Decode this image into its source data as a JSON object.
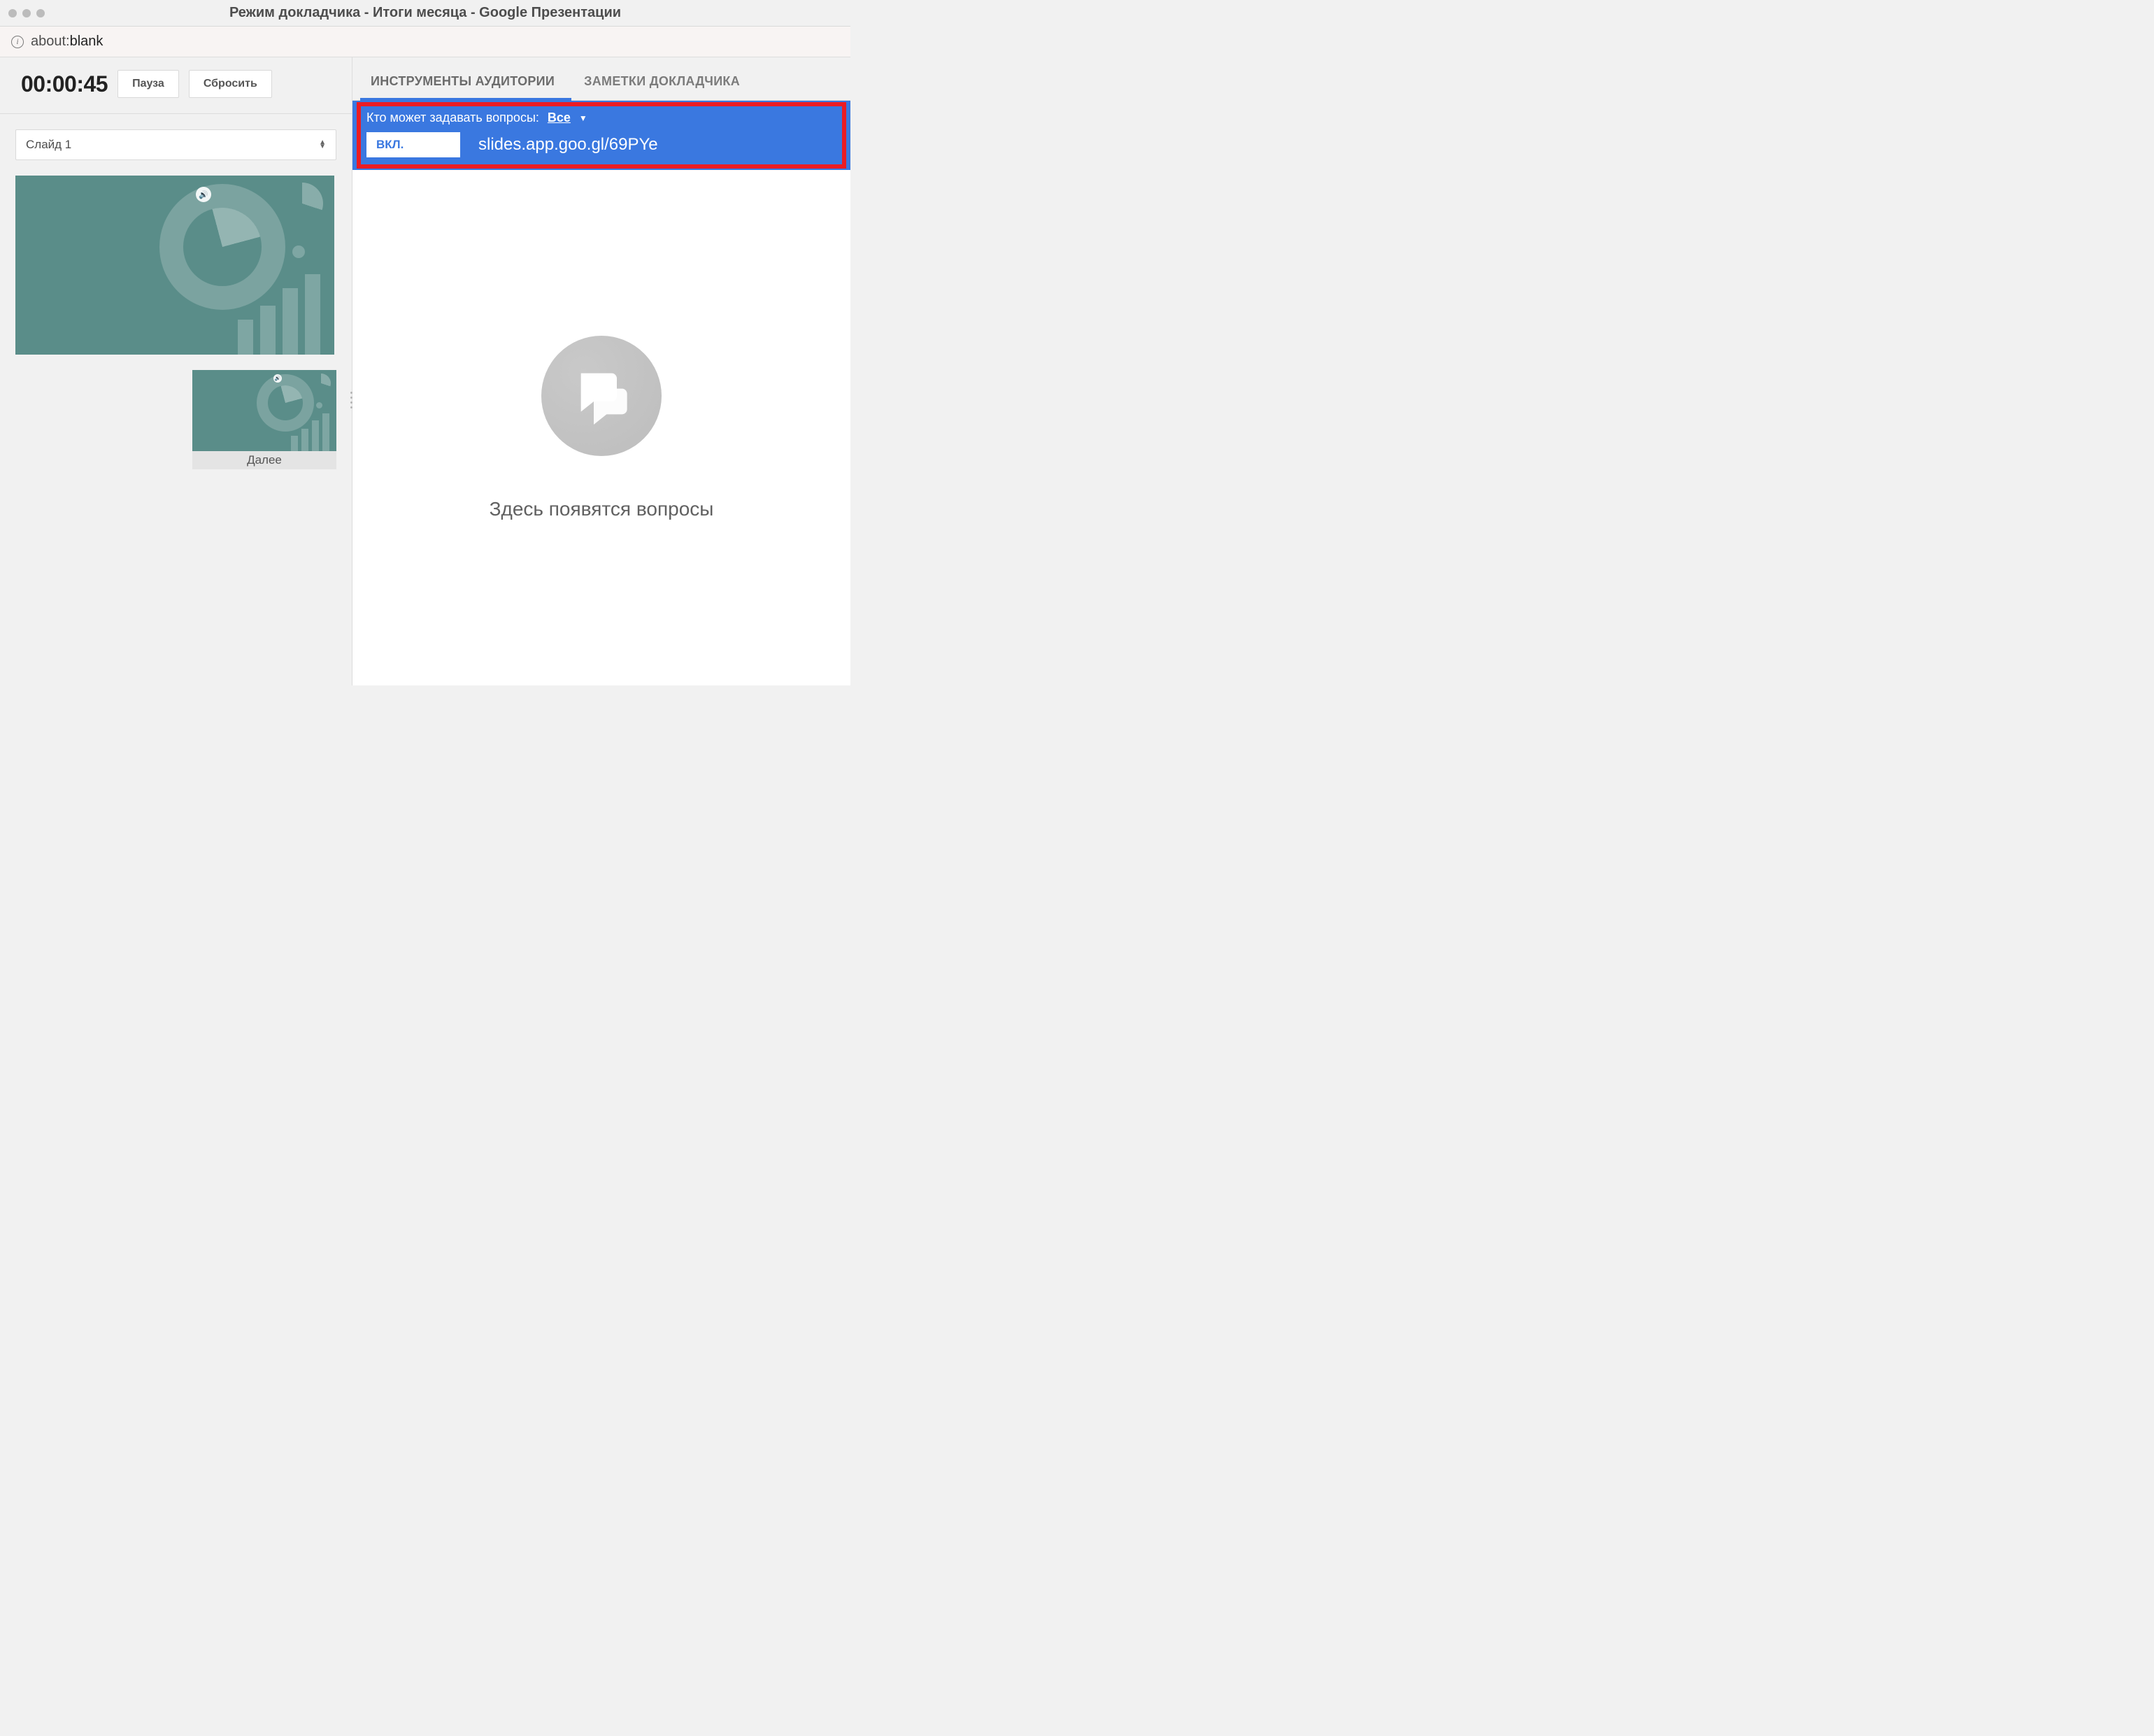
{
  "window": {
    "title": "Режим докладчика - Итоги месяца - Google Презентации"
  },
  "urlbar": {
    "prefix": "about:",
    "path": "blank"
  },
  "timer": {
    "value": "00:00:45",
    "pause_label": "Пауза",
    "reset_label": "Сбросить"
  },
  "slide_selector": {
    "current": "Слайд 1"
  },
  "next_slide": {
    "label": "Далее"
  },
  "tabs": {
    "audience_tools": "ИНСТРУМЕНТЫ АУДИТОРИИ",
    "speaker_notes": "ЗАМЕТКИ ДОКЛАДЧИКА"
  },
  "qa": {
    "who_label": "Кто может задавать вопросы:",
    "who_value": "Все",
    "toggle_label": "ВКЛ.",
    "short_url": "slides.app.goo.gl/69PYe",
    "empty_text": "Здесь появятся вопросы"
  }
}
